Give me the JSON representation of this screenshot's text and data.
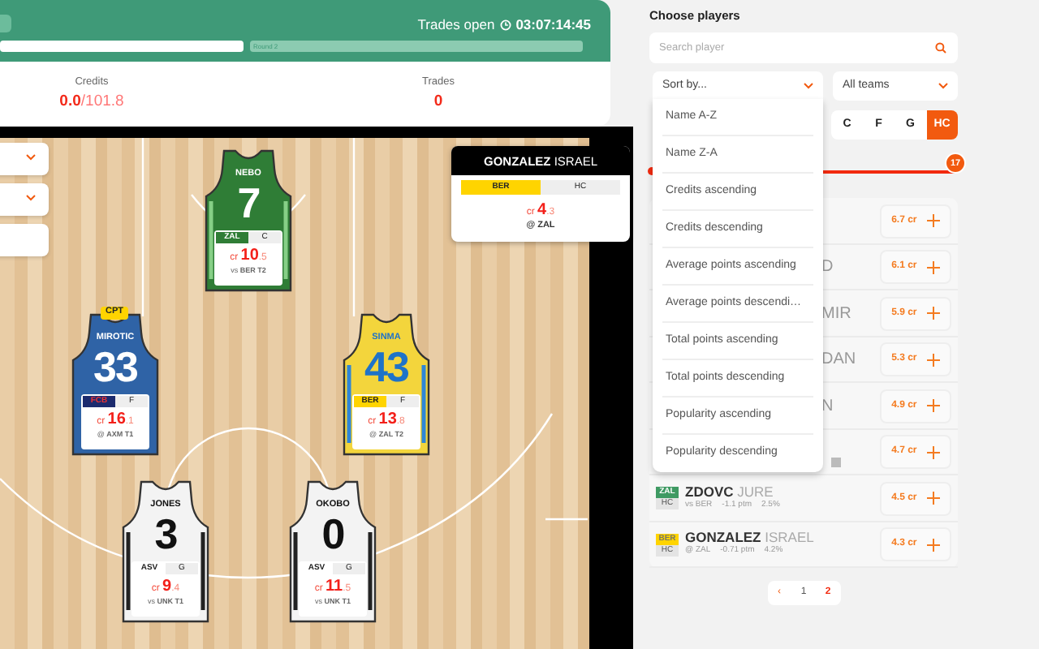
{
  "header": {
    "status": "Trades open",
    "countdown": "03:07:14:45",
    "rounds": [
      {
        "selected": true
      },
      {
        "label": "Round 2",
        "selected": false
      }
    ]
  },
  "summary": {
    "credits_label": "Credits",
    "credits_used": "0.0",
    "credits_total": "/101.8",
    "trades_label": "Trades",
    "trades_value": "0"
  },
  "side_controls": [
    {
      "kind": "dropdown"
    },
    {
      "kind": "dropdown"
    },
    {
      "kind": "plain"
    }
  ],
  "jerseys": [
    {
      "name": "NEBO",
      "number": "7",
      "color": "#2f7d36",
      "stripes": {
        "color": "#86cf86"
      },
      "lettering": {
        "color": "#ffffff"
      },
      "team": {
        "label": "ZAL",
        "color": "#2f7d36"
      },
      "position": "C",
      "credits": {
        "unit": "cr",
        "whole": "10",
        "fraction": ".5"
      },
      "opponent": "vs **BER T2**"
    },
    {
      "name": "MIROTIC",
      "number": "33",
      "color": "#2f63a6",
      "lettering": {
        "color": "#ffffff"
      },
      "team": {
        "label": "FCB",
        "color": "#1c2b6e"
      },
      "position": "F",
      "credits": {
        "unit": "cr",
        "whole": "16",
        "fraction": ".1"
      },
      "opponent": "@ **AXM T1**",
      "captain": "CPT"
    },
    {
      "name": "SINMA",
      "number": "43",
      "color": "#f3d53c",
      "stripes": {
        "color": "#2f86d6"
      },
      "lettering": {
        "color": "#1f73c8"
      },
      "team": {
        "label": "BER",
        "color": "#ffd400"
      },
      "position": "F",
      "credits": {
        "unit": "cr",
        "whole": "13",
        "fraction": ".8"
      },
      "opponent": "@ **ZAL T2**"
    },
    {
      "name": "JONES",
      "number": "3",
      "color": "#f3f3f3",
      "stripes": {
        "color": "#222222"
      },
      "lettering": {
        "color": "#111111"
      },
      "team": {
        "label": "ASV",
        "color": "#ffffff"
      },
      "position": "G",
      "credits": {
        "unit": "cr",
        "whole": "9",
        "fraction": ".4"
      },
      "opponent": "vs **UNK T1**"
    },
    {
      "name": "OKOBO",
      "number": "0",
      "color": "#f3f3f3",
      "stripes": {
        "color": "#222222"
      },
      "lettering": {
        "color": "#111111"
      },
      "team": {
        "label": "ASV",
        "color": "#ffffff"
      },
      "position": "G",
      "credits": {
        "unit": "cr",
        "whole": "11",
        "fraction": ".5"
      },
      "opponent": "vs **UNK T1**"
    }
  ],
  "popup": {
    "last": "GONZALEZ",
    "first": "ISRAEL",
    "team": {
      "label": "BER",
      "color": "#ffd400"
    },
    "position": "HC",
    "credits": {
      "unit": "cr",
      "whole": "4",
      "fraction": ".3"
    },
    "opponent": "@ ZAL"
  },
  "panel": {
    "title": "Choose players",
    "search": {
      "placeholder": "Search player"
    },
    "sort": {
      "label": "Sort by...",
      "expanded": true
    },
    "teams": {
      "label": "All teams"
    },
    "positions": [
      {
        "label": "C",
        "selected": false
      },
      {
        "label": "F",
        "selected": false
      },
      {
        "label": "G",
        "selected": false
      },
      {
        "label": "HC",
        "selected": true
      }
    ],
    "slider": {
      "level": 1,
      "reading": "17"
    },
    "sort_options": [
      "Name A-Z",
      "Name Z-A",
      "Credits ascending",
      "Credits descending",
      "Average points ascending",
      "Average points descendi…",
      "Total points ascending",
      "Total points descending",
      "Popularity ascending",
      "Popularity descending"
    ],
    "players": [
      {
        "kind": "partial",
        "price": "6.7 cr"
      },
      {
        "kind": "partial",
        "fragment": "D",
        "price": "6.1 cr"
      },
      {
        "kind": "partial",
        "fragment": "MIR",
        "price": "5.9 cr"
      },
      {
        "kind": "partial",
        "fragment": "DAN",
        "price": "5.3 cr"
      },
      {
        "kind": "partial",
        "fragment": "N",
        "price": "4.9 cr"
      },
      {
        "kind": "partial",
        "tag_peek": true,
        "price": "4.7 cr"
      },
      {
        "kind": "player",
        "team": {
          "label": "ZAL",
          "color": "#3f9a63"
        },
        "position": "HC",
        "last": "ZDOVC",
        "first": "JURE",
        "opponent": "vs BER",
        "points": "-1.1 ptm",
        "popularity": "2.5%",
        "price": "4.5 cr"
      },
      {
        "kind": "player",
        "team": {
          "label": "BER",
          "color": "#ffd400"
        },
        "position": "HC",
        "last": "GONZALEZ",
        "first": "ISRAEL",
        "opponent": "@ ZAL",
        "points": "-0.71 ptm",
        "popularity": "4.2%",
        "price": "4.3 cr"
      }
    ],
    "pagination": [
      {
        "label": "‹",
        "kind": "prev",
        "selected": false
      },
      {
        "label": "1",
        "kind": "page",
        "selected": false
      },
      {
        "label": "2",
        "kind": "page",
        "selected": true
      }
    ]
  }
}
